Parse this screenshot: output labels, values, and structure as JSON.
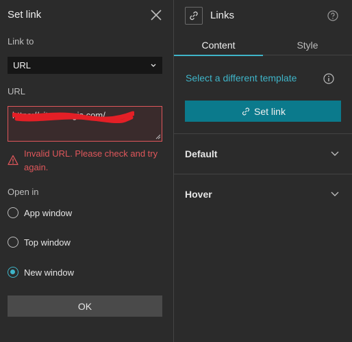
{
  "left_panel": {
    "title": "Set link",
    "link_to_label": "Link to",
    "link_to_value": "URL",
    "url_label": "URL",
    "url_value": "https://sites.arcgis.com/",
    "error_message": "Invalid URL. Please check and try again.",
    "open_in_label": "Open in",
    "open_in_options": [
      {
        "label": "App window",
        "selected": false
      },
      {
        "label": "Top window",
        "selected": false
      },
      {
        "label": "New window",
        "selected": true
      }
    ],
    "ok_label": "OK"
  },
  "right_panel": {
    "title": "Links",
    "tabs": [
      {
        "label": "Content",
        "active": true
      },
      {
        "label": "Style",
        "active": false
      }
    ],
    "template_link": "Select a different template",
    "set_link_label": "Set link",
    "sections": [
      {
        "label": "Default"
      },
      {
        "label": "Hover"
      }
    ]
  },
  "icons": {
    "close": "close-icon",
    "chevron": "chevron-down-icon",
    "warning": "warning-icon",
    "link": "link-icon",
    "help": "help-icon",
    "info": "info-icon"
  },
  "colors": {
    "accent": "#3fb5c9",
    "button_primary": "#0b7a8c",
    "error": "#e0575b",
    "redaction": "#e41f26",
    "background": "#2b2b2b"
  }
}
